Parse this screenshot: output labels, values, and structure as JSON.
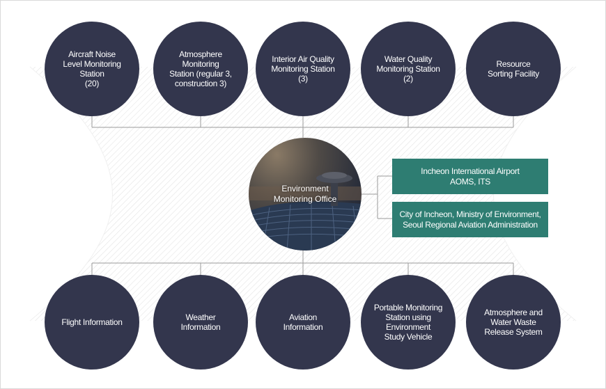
{
  "colors": {
    "circle_fill": "#33364d",
    "box_fill": "#2e7d72",
    "connector": "#9a9a9a",
    "text_light": "#ffffff"
  },
  "top_nodes": [
    {
      "label": "Aircraft Noise\nLevel Monitoring Station\n(20)"
    },
    {
      "label": "Atmosphere\nMonitoring\nStation (regular 3,\nconstruction 3)"
    },
    {
      "label": "Interior Air Quality\nMonitoring Station\n(3)"
    },
    {
      "label": "Water Quality\nMonitoring Station\n(2)"
    },
    {
      "label": "Resource\nSorting Facility"
    }
  ],
  "center_node": {
    "label": "Environment\nMonitoring Office"
  },
  "side_boxes": [
    {
      "label": "Incheon International Airport\nAOMS, ITS"
    },
    {
      "label": "City of Incheon, Ministry of Environment,\nSeoul Regional Aviation Administration"
    }
  ],
  "bottom_nodes": [
    {
      "label": "Flight Information"
    },
    {
      "label": "Weather\nInformation"
    },
    {
      "label": "Aviation\nInformation"
    },
    {
      "label": "Portable Monitoring\nStation using\nEnvironment\nStudy Vehicle"
    },
    {
      "label": "Atmosphere and\nWater Waste\nRelease System"
    }
  ]
}
